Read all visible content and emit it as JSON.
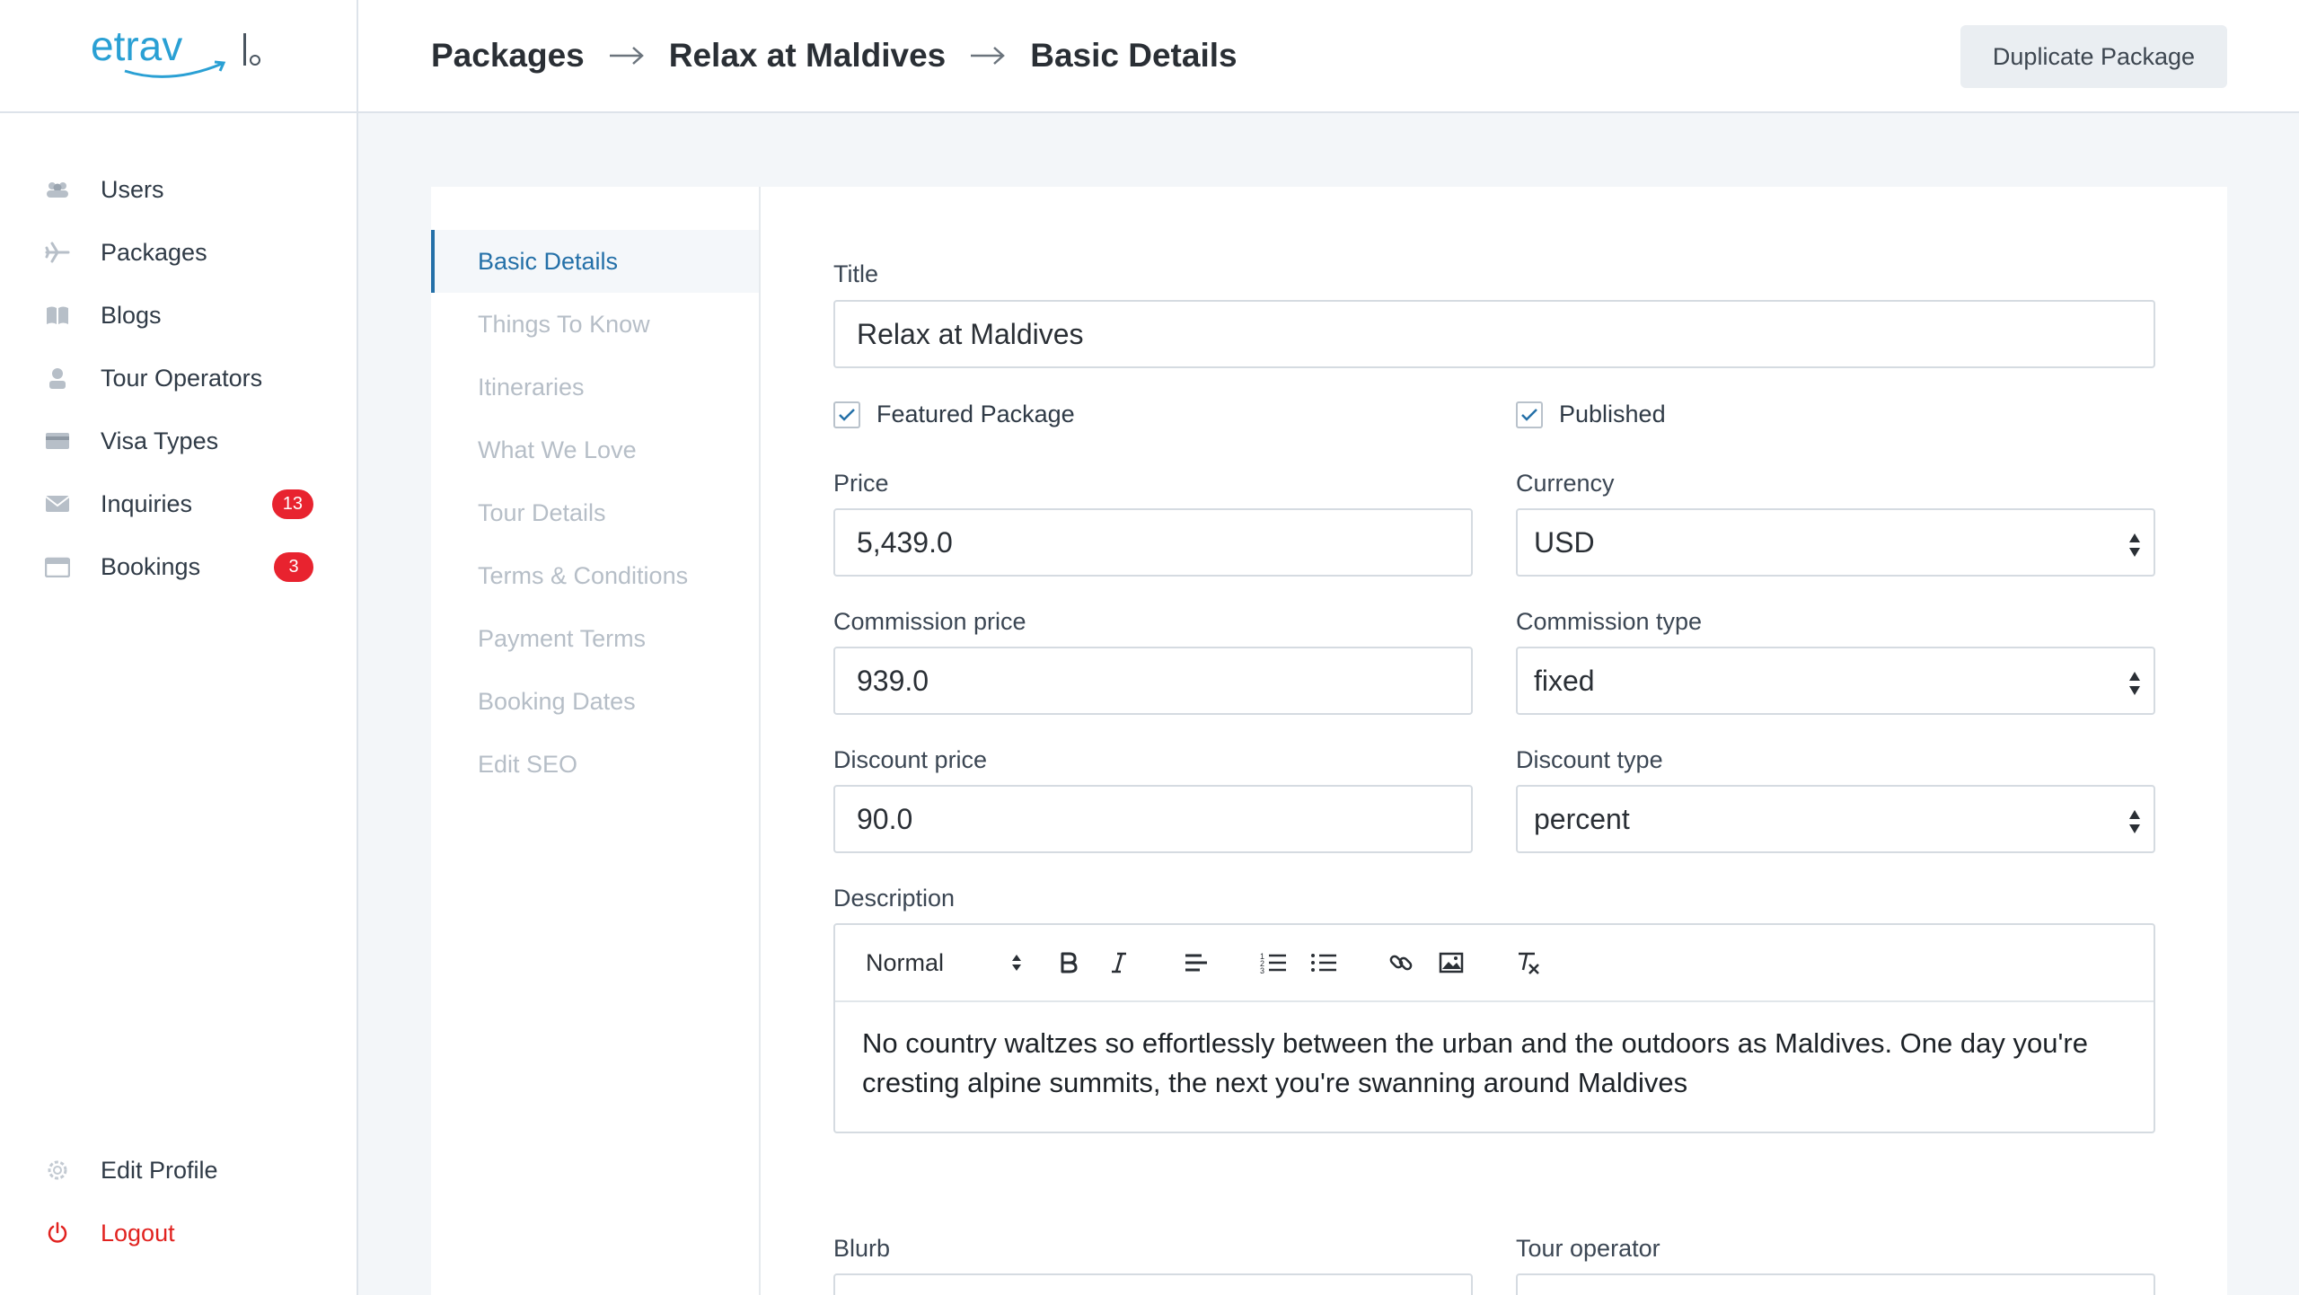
{
  "app": {
    "logo_text": "etravle"
  },
  "sidebar": {
    "items": [
      {
        "label": "Users",
        "icon": "users-icon"
      },
      {
        "label": "Packages",
        "icon": "plane-icon"
      },
      {
        "label": "Blogs",
        "icon": "book-icon"
      },
      {
        "label": "Tour Operators",
        "icon": "person-icon"
      },
      {
        "label": "Visa Types",
        "icon": "card-icon"
      },
      {
        "label": "Inquiries",
        "icon": "mail-icon",
        "badge": "13"
      },
      {
        "label": "Bookings",
        "icon": "calendar-icon",
        "badge": "3"
      }
    ],
    "bottom": [
      {
        "label": "Edit Profile",
        "icon": "gear-icon"
      },
      {
        "label": "Logout",
        "icon": "power-icon"
      }
    ]
  },
  "header": {
    "breadcrumb": [
      "Packages",
      "Relax at Maldives",
      "Basic Details"
    ],
    "duplicate_label": "Duplicate Package"
  },
  "subnav": {
    "items": [
      "Basic Details",
      "Things To Know",
      "Itineraries",
      "What We Love",
      "Tour Details",
      "Terms & Conditions",
      "Payment Terms",
      "Booking Dates",
      "Edit SEO"
    ],
    "active": "Basic Details"
  },
  "form": {
    "title_label": "Title",
    "title_value": "Relax at Maldives",
    "featured_label": "Featured Package",
    "featured_checked": true,
    "published_label": "Published",
    "published_checked": true,
    "price_label": "Price",
    "price_value": "5,439.0",
    "currency_label": "Currency",
    "currency_value": "USD",
    "commission_price_label": "Commission price",
    "commission_price_value": "939.0",
    "commission_type_label": "Commission type",
    "commission_type_value": "fixed",
    "discount_price_label": "Discount price",
    "discount_price_value": "90.0",
    "discount_type_label": "Discount type",
    "discount_type_value": "percent",
    "description_label": "Description",
    "editor_heading": "Normal",
    "description_text": "No country waltzes so effortlessly between the urban and the outdoors as Maldives. One day you're cresting alpine summits, the next you're swanning around Maldives",
    "blurb_label": "Blurb",
    "tour_operator_label": "Tour operator"
  },
  "colors": {
    "accent": "#2470a8",
    "badge": "#e8232f",
    "logout": "#e1221f",
    "logo": "#2aa0d4"
  }
}
